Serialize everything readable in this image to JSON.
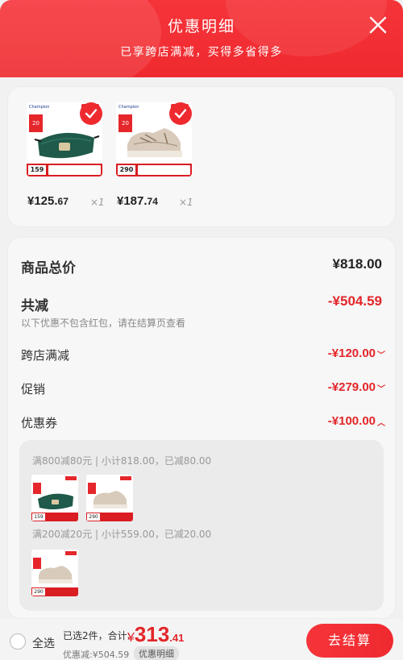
{
  "header": {
    "title": "优惠明细",
    "subtitle": "已享跨店满减，买得多省得多"
  },
  "products": [
    {
      "image": "waist-bag-image",
      "price_int": "¥125.",
      "price_dec": "67",
      "qty": "×1",
      "tag_price": "159"
    },
    {
      "image": "sneaker-image",
      "price_int": "¥187.",
      "price_dec": "74",
      "qty": "×1",
      "tag_price": "290"
    }
  ],
  "summary": {
    "total_label": "商品总价",
    "total_value": "¥818.00",
    "reduced_label": "共减",
    "reduced_value": "-¥504.59",
    "note": "以下优惠不包含红包，请在结算页查看"
  },
  "discounts": [
    {
      "label": "跨店满减",
      "value": "-¥120.00",
      "chevron": "chevron-down-icon"
    },
    {
      "label": "促销",
      "value": "-¥279.00",
      "chevron": "chevron-down-icon"
    },
    {
      "label": "优惠券",
      "value": "-¥100.00",
      "chevron": "chevron-up-icon"
    }
  ],
  "coupons": [
    {
      "text": "满800减80元 | 小计818.00，已减80.00"
    },
    {
      "text": "满200减20元 | 小计559.00，已减20.00"
    }
  ],
  "bottom": {
    "select_all": "全选",
    "selected_text": "已选2件，合计:",
    "total_yen": "¥",
    "total_int": "313",
    "total_dec": ".41",
    "reduced_text": "优惠减:¥504.59",
    "detail_link": "优惠明细",
    "checkout": "去结算"
  },
  "colors": {
    "accent": "#ef2a2f",
    "price_red": "#e3262a"
  }
}
